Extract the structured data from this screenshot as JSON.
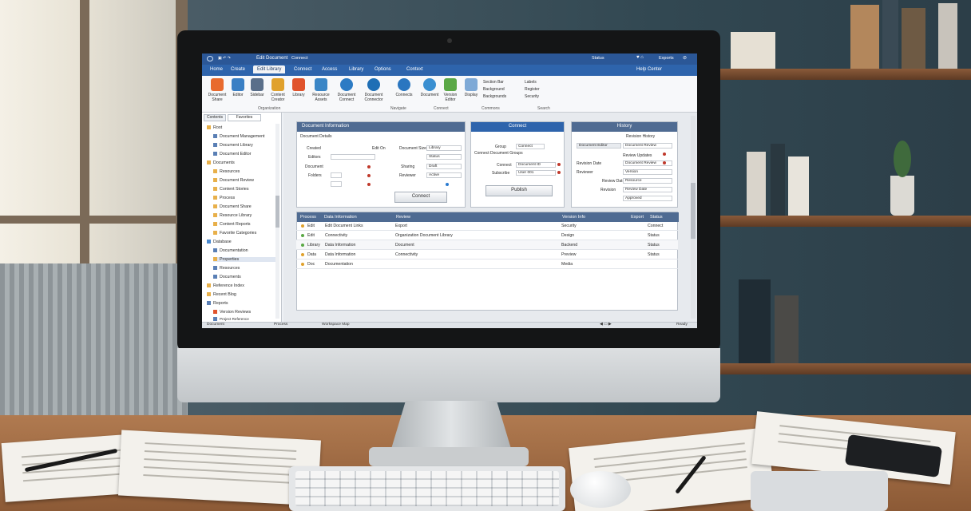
{
  "screen": {
    "titlebar": {
      "app_title": "Edit Document",
      "mode": "Connect",
      "right_text": "Status",
      "account_text": "Exports"
    },
    "tabs": [
      {
        "label": "Home"
      },
      {
        "label": "Create"
      },
      {
        "label": "Edit Library",
        "active": true
      },
      {
        "label": "Connect"
      },
      {
        "label": "Access"
      },
      {
        "label": "Library"
      },
      {
        "label": "Options"
      },
      {
        "label": "Context"
      }
    ],
    "tabbar_right": "Help Center",
    "ribbon": {
      "buttons": [
        {
          "label": "Document Share",
          "color": "#e86a2e"
        },
        {
          "label": "Editor",
          "color": "#3a7fc4"
        },
        {
          "label": "Sidebar",
          "color": "#5a6f8a"
        },
        {
          "label": "Content Creator",
          "color": "#e0a12c"
        },
        {
          "label": "Library",
          "color": "#e0532c"
        },
        {
          "label": "Resource Assets",
          "color": "#3b86c6"
        },
        {
          "label": "Document Connect",
          "color": "#2c7bc4"
        },
        {
          "label": "Document Connector",
          "color": "#1f6fb5"
        },
        {
          "label": "Connects",
          "color": "#2a76c0"
        },
        {
          "label": "Document",
          "color": "#3a8fd1"
        },
        {
          "label": "Version Editor",
          "color": "#5aa846"
        },
        {
          "label": "Display",
          "color": "#7ea9d6"
        }
      ],
      "small_items": [
        "Section Bar",
        "Background",
        "Backgrounds"
      ],
      "small_items2": [
        "Labels",
        "Register",
        "Security"
      ],
      "groups": [
        "Organization",
        "Navigate",
        "Connect",
        "Commons",
        "Search"
      ]
    },
    "left_panel": {
      "tabs": [
        "Contents",
        "Favorites"
      ],
      "items": [
        "Root",
        "Document Management",
        "Document Library",
        "Document Editor",
        "Documents",
        "Resources",
        "Document Review",
        "Content Stories",
        "Process",
        "Document Share",
        "Resource Library",
        "Content Reports",
        "Favorite Categories",
        "Database",
        "Documentation",
        "Properties",
        "Resources",
        "Documents",
        "Reference Index",
        "Recent Blog",
        "Reports",
        "Version Reviews",
        "Project Reference"
      ]
    },
    "panel_details": {
      "title": "Document Information",
      "subtitle": "Document Details",
      "labels": [
        "Created",
        "Editors",
        "Document",
        "Folders"
      ],
      "fields": [
        "Edit On",
        "Document Size",
        "Sharing",
        "Reviewer"
      ],
      "values": [
        "Library",
        "Status",
        "Draft",
        "Active"
      ],
      "button": "Connect"
    },
    "panel_connect": {
      "title": "Connect",
      "labels": [
        "Group",
        "Connect Document Groups",
        "Connect",
        "Subscribe"
      ],
      "values": [
        "Connect",
        "Document ID",
        "User 001"
      ],
      "button": "Publish"
    },
    "panel_history": {
      "title": "History",
      "label": "Document Editor",
      "items": [
        "Revision History",
        "Document Review",
        "Review Updates",
        "Revision Date",
        "Document Review",
        "Reviewer",
        "Review Date",
        "Revision"
      ],
      "rows": [
        "Version",
        "Resource",
        "Review Date",
        "Approved",
        "Version"
      ]
    },
    "table": {
      "headers": [
        "Process",
        "Data Information",
        "Review",
        "Version Info",
        "Export",
        "Status"
      ],
      "rows": [
        [
          "Edit",
          "Edit Document Links",
          "Export",
          "Security",
          "Connect"
        ],
        [
          "Edit",
          "Connectivity",
          "Organization Document Library",
          "Design",
          "Status"
        ],
        [
          "Library",
          "Data Information",
          "Document",
          "Backend",
          "Status"
        ],
        [
          "Data",
          "Data Information",
          "Connectivity",
          "Preview",
          "Status"
        ],
        [
          "Doc",
          "Documentation",
          "",
          "Media",
          ""
        ]
      ]
    },
    "statusbar": {
      "left": "Document",
      "mid1": "Process",
      "mid2": "Workspace Map",
      "right": "Ready"
    }
  }
}
